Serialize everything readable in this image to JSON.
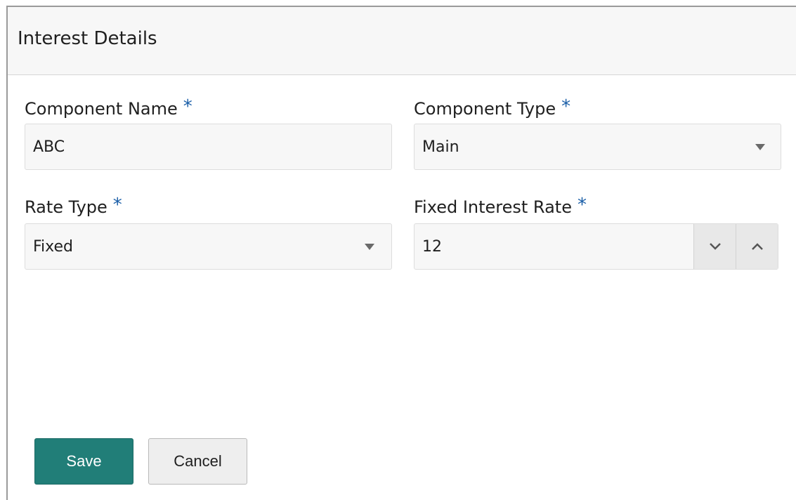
{
  "dialog": {
    "title": "Interest Details"
  },
  "fields": {
    "component_name": {
      "label": "Component Name",
      "required_mark": "*",
      "value": "ABC"
    },
    "component_type": {
      "label": "Component Type",
      "required_mark": "*",
      "value": "Main"
    },
    "rate_type": {
      "label": "Rate Type",
      "required_mark": "*",
      "value": "Fixed"
    },
    "fixed_interest_rate": {
      "label": "Fixed Interest Rate",
      "required_mark": "*",
      "value": "12"
    }
  },
  "actions": {
    "save_label": "Save",
    "cancel_label": "Cancel"
  },
  "icons": {
    "dropdown": "chevron-down-icon",
    "decrement": "chevron-down-icon",
    "increment": "chevron-up-icon"
  },
  "colors": {
    "accent": "#217e78",
    "required": "#1b5fa8",
    "header_bg": "#f7f7f7",
    "input_bg": "#f7f7f7"
  }
}
